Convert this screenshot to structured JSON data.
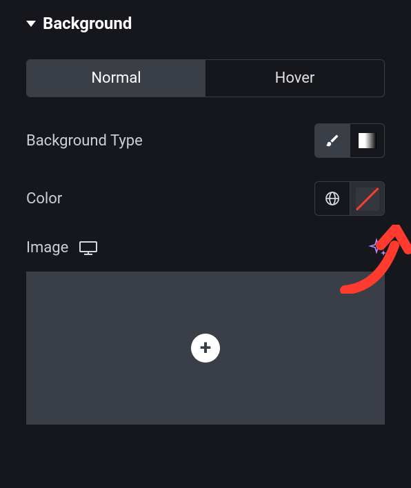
{
  "section": {
    "title": "Background"
  },
  "tabs": {
    "normal": "Normal",
    "hover": "Hover"
  },
  "rows": {
    "bgType": "Background Type",
    "color": "Color",
    "image": "Image"
  },
  "icons": {
    "brush": "brush",
    "gradient": "gradient",
    "globe": "globe",
    "device": "desktop",
    "sparkle": "ai-sparkle",
    "plus": "+"
  }
}
